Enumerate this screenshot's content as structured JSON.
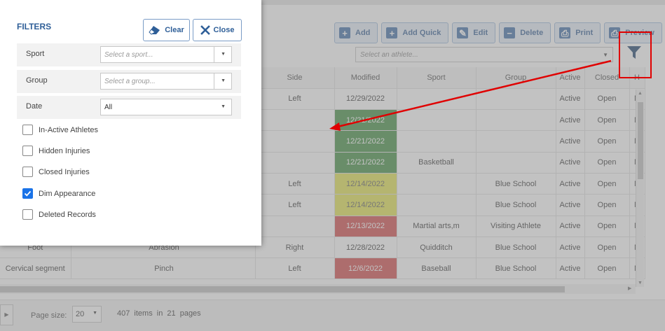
{
  "toolbar": {
    "buttons": [
      {
        "label": "Add",
        "icon": "+"
      },
      {
        "label": "Add Quick",
        "icon": "+"
      },
      {
        "label": "Edit",
        "icon": "✎"
      },
      {
        "label": "Delete",
        "icon": "−"
      },
      {
        "label": "Print",
        "icon": "⎙"
      },
      {
        "label": "Preview",
        "icon": "⎙"
      }
    ],
    "athlete_placeholder": "Select an athlete..."
  },
  "grid": {
    "headers": [
      "",
      "",
      "Side",
      "Modified",
      "Sport",
      "Group",
      "Active",
      "Closed",
      "H"
    ],
    "rows": [
      [
        "",
        "",
        "Left",
        "12/29/2022",
        "",
        "",
        "Active",
        "Open",
        "N"
      ],
      [
        "",
        "",
        "",
        "12/21/2022",
        "",
        "",
        "Active",
        "Open",
        "N"
      ],
      [
        "",
        "",
        "",
        "12/21/2022",
        "",
        "",
        "Active",
        "Open",
        "N"
      ],
      [
        "",
        "",
        "",
        "12/21/2022",
        "Basketball",
        "",
        "Active",
        "Open",
        "N"
      ],
      [
        "",
        "",
        "Left",
        "12/14/2022",
        "",
        "Blue School",
        "Active",
        "Open",
        "N"
      ],
      [
        "",
        "",
        "Left",
        "12/14/2022",
        "",
        "Blue School",
        "Active",
        "Open",
        "N"
      ],
      [
        "",
        "",
        "",
        "12/13/2022",
        "Martial arts,m",
        "Visiting Athlete",
        "Active",
        "Open",
        "N"
      ],
      [
        "Foot",
        "Abrasion",
        "Right",
        "12/28/2022",
        "Quidditch",
        "Blue School",
        "Active",
        "Open",
        "N"
      ],
      [
        "Cervical segment",
        "Pinch",
        "Left",
        "12/6/2022",
        "Baseball",
        "Blue School",
        "Active",
        "Open",
        "N"
      ]
    ],
    "modified_colors": [
      "",
      "green",
      "green",
      "green",
      "yellow",
      "yellow",
      "red",
      "",
      "red"
    ]
  },
  "pager": {
    "page_size_label": "Page size:",
    "page_size": "20",
    "total_items": "407",
    "items_in_text": "items in",
    "total_pages": "21",
    "pages_text": "pages"
  },
  "filters": {
    "title": "FILTERS",
    "clear_label": "Clear",
    "close_label": "Close",
    "sport": {
      "label": "Sport",
      "placeholder": "Select a sport..."
    },
    "group": {
      "label": "Group",
      "placeholder": "Select a group..."
    },
    "date": {
      "label": "Date",
      "value": "All"
    },
    "checkboxes": [
      {
        "label": "In-Active Athletes",
        "checked": false
      },
      {
        "label": "Hidden Injuries",
        "checked": false
      },
      {
        "label": "Closed Injuries",
        "checked": false
      },
      {
        "label": "Dim Appearance",
        "checked": true
      },
      {
        "label": "Deleted Records",
        "checked": false
      }
    ]
  },
  "colors": {
    "accent": "#2f5f98",
    "highlight": "#e00000",
    "checkbox_on": "#1a73e8"
  }
}
